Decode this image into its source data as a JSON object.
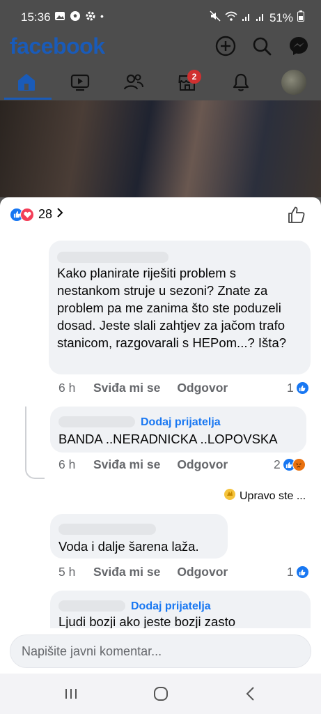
{
  "status_bar": {
    "time": "15:36",
    "battery": "51%",
    "left_icons": [
      "gallery-icon",
      "soccer-icon",
      "gear-icon",
      "dot"
    ],
    "right_icons": [
      "mute-icon",
      "wifi-icon",
      "signal-icon",
      "signal-icon",
      "battery-icon"
    ]
  },
  "header": {
    "logo": "facebook",
    "buttons": [
      "add-icon",
      "search-icon",
      "messenger-icon"
    ]
  },
  "tabs": [
    {
      "name": "home",
      "icon": "home-icon",
      "active": true
    },
    {
      "name": "video",
      "icon": "video-icon"
    },
    {
      "name": "friends",
      "icon": "friends-icon"
    },
    {
      "name": "marketplace",
      "icon": "marketplace-icon",
      "badge": "2"
    },
    {
      "name": "notifications",
      "icon": "bell-icon"
    },
    {
      "name": "profile",
      "icon": "avatar"
    }
  ],
  "reactions": {
    "types": [
      "like",
      "love"
    ],
    "count": "28"
  },
  "comments": [
    {
      "text": "Kako planirate riješiti problem s nestankom struje u sezoni? Znate za problem pa me zanima što ste poduzeli dosad. Jeste slali zahtjev za jačom trafo stanicom, razgovarali s HEPom...? Išta?",
      "time": "6 h",
      "like_label": "Sviđa mi se",
      "reply_label": "Odgovor",
      "reaction_count": "1",
      "reactions": [
        "like"
      ]
    },
    {
      "add_friend": "Dodaj prijatelja",
      "text": "BANDA ..NERADNICKA ..LOPOVSKA",
      "time": "6 h",
      "like_label": "Sviđa mi se",
      "reply_label": "Odgovor",
      "reaction_count": "2",
      "reactions": [
        "like",
        "angry"
      ]
    },
    {
      "text": "Voda i dalje šarena laža.",
      "time": "5 h",
      "like_label": "Sviđa mi se",
      "reply_label": "Odgovor",
      "reaction_count": "1",
      "reactions": [
        "like"
      ]
    },
    {
      "add_friend": "Dodaj prijatelja",
      "text": "Ljudi bozji ako jeste bozji zasto"
    }
  ],
  "typing_indicator": "Upravo ste ...",
  "comment_input": {
    "placeholder": "Napišite javni komentar..."
  },
  "colors": {
    "brand": "#1a5bb8",
    "like": "#1877f2",
    "love": "#f33e58",
    "angry": "#f7b125"
  }
}
